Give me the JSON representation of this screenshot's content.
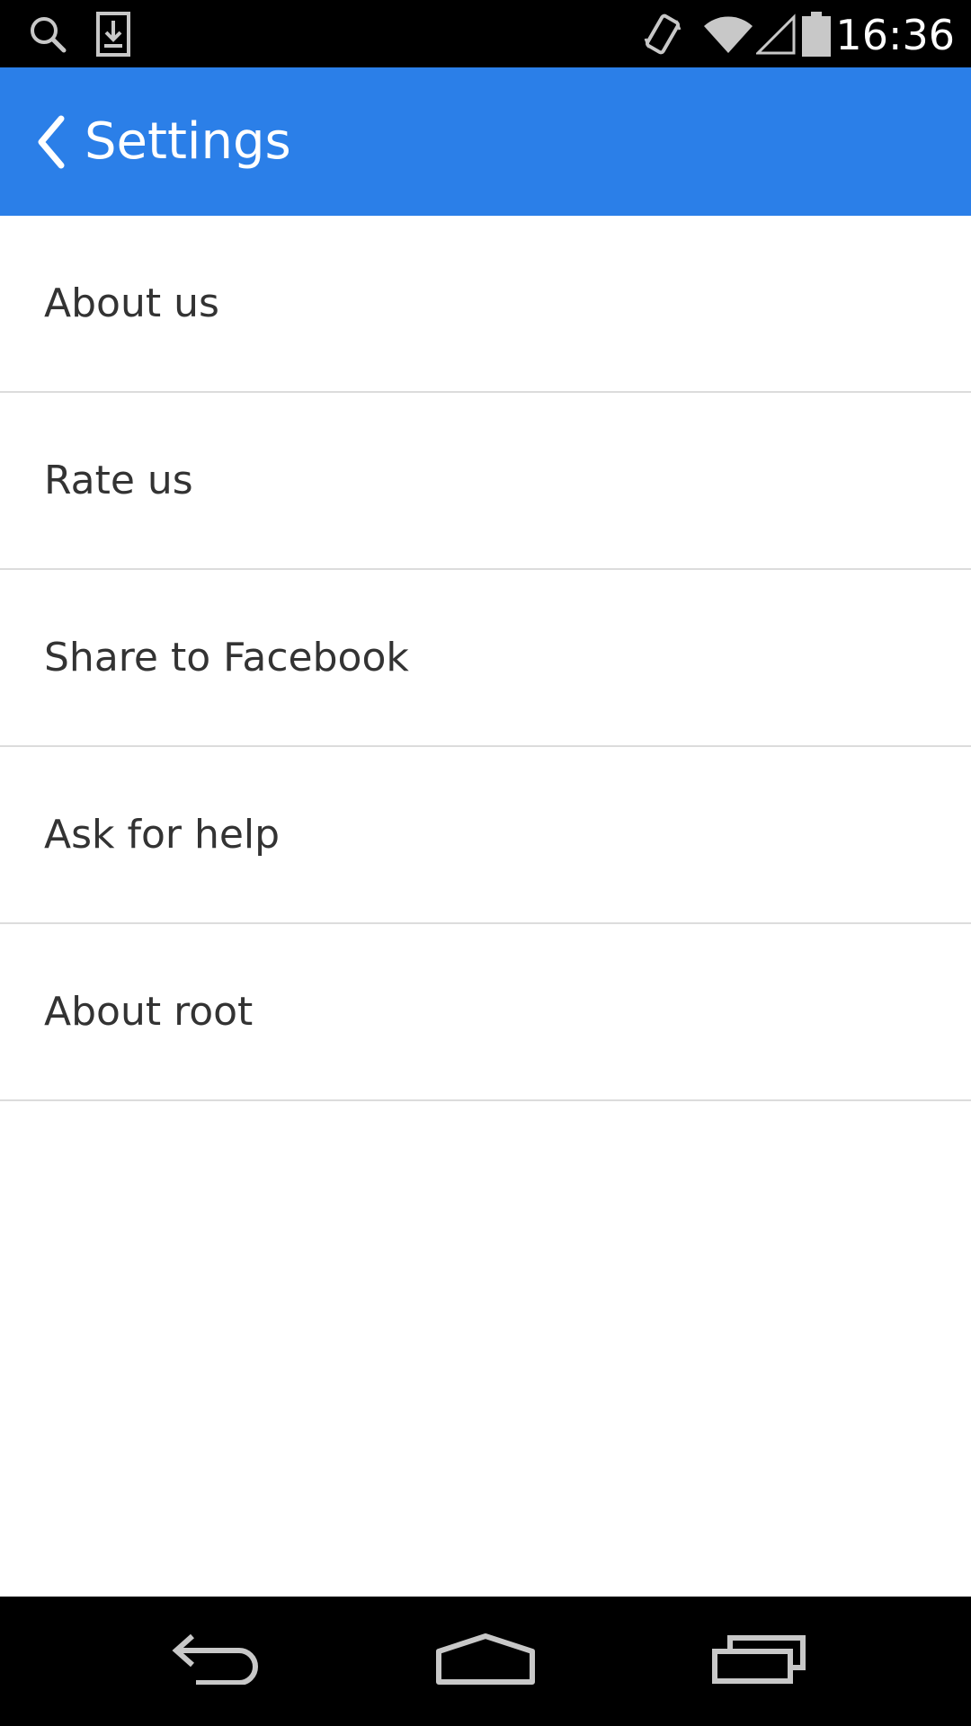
{
  "status_bar": {
    "time": "16:36",
    "icons": [
      "search-icon",
      "download-icon",
      "vibrate-icon",
      "wifi-icon",
      "signal-icon",
      "battery-icon"
    ]
  },
  "app_bar": {
    "title": "Settings",
    "back_icon": "chevron-left-icon",
    "background_color": "#2b7fe8"
  },
  "settings": {
    "items": [
      {
        "label": "About us"
      },
      {
        "label": "Rate us"
      },
      {
        "label": "Share to Facebook"
      },
      {
        "label": "Ask for help"
      },
      {
        "label": "About root"
      }
    ]
  },
  "nav_bar": {
    "icons": [
      "back-icon",
      "home-icon",
      "recents-icon"
    ]
  }
}
